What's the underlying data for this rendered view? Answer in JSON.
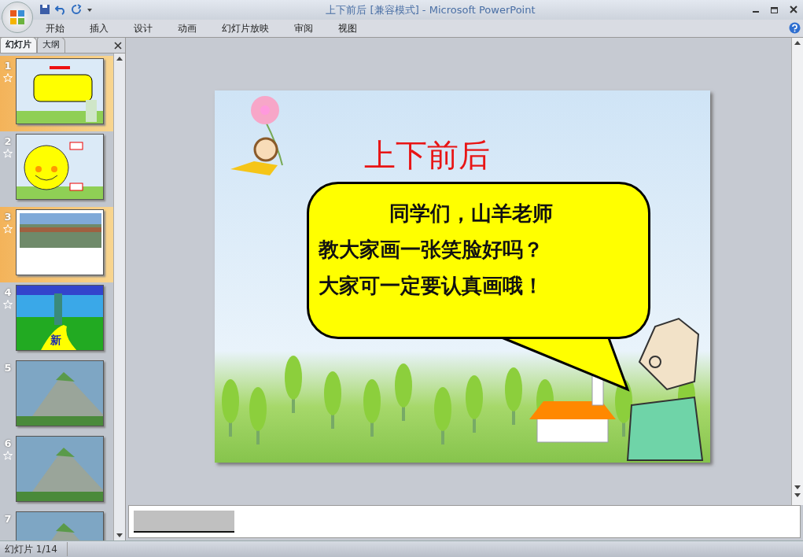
{
  "window": {
    "title": "上下前后 [兼容模式] - Microsoft PowerPoint"
  },
  "ribbon_tabs": [
    {
      "label": "开始"
    },
    {
      "label": "插入"
    },
    {
      "label": "设计"
    },
    {
      "label": "动画"
    },
    {
      "label": "幻灯片放映"
    },
    {
      "label": "审阅"
    },
    {
      "label": "视图"
    }
  ],
  "panel_tabs": [
    {
      "label": "幻灯片",
      "selected": true
    },
    {
      "label": "大纲",
      "selected": false
    }
  ],
  "slides": [
    {
      "number": "1",
      "animated": true,
      "selected": true,
      "kind": "speech"
    },
    {
      "number": "2",
      "animated": true,
      "selected": false,
      "kind": "face"
    },
    {
      "number": "3",
      "animated": true,
      "selected": true,
      "kind": "photo"
    },
    {
      "number": "4",
      "animated": true,
      "selected": false,
      "kind": "road",
      "label": "新"
    },
    {
      "number": "5",
      "animated": false,
      "selected": false,
      "kind": "mountain"
    },
    {
      "number": "6",
      "animated": true,
      "selected": false,
      "kind": "mountain"
    },
    {
      "number": "7",
      "animated": false,
      "selected": false,
      "kind": "mountain"
    }
  ],
  "slide": {
    "title": "上下前后",
    "bubble_lines": [
      "同学们，山羊老师",
      "教大家画一张笑脸好吗？",
      "大家可一定要认真画哦！"
    ]
  },
  "status_bar": {
    "slide_counter": "幻灯片 1/14"
  }
}
